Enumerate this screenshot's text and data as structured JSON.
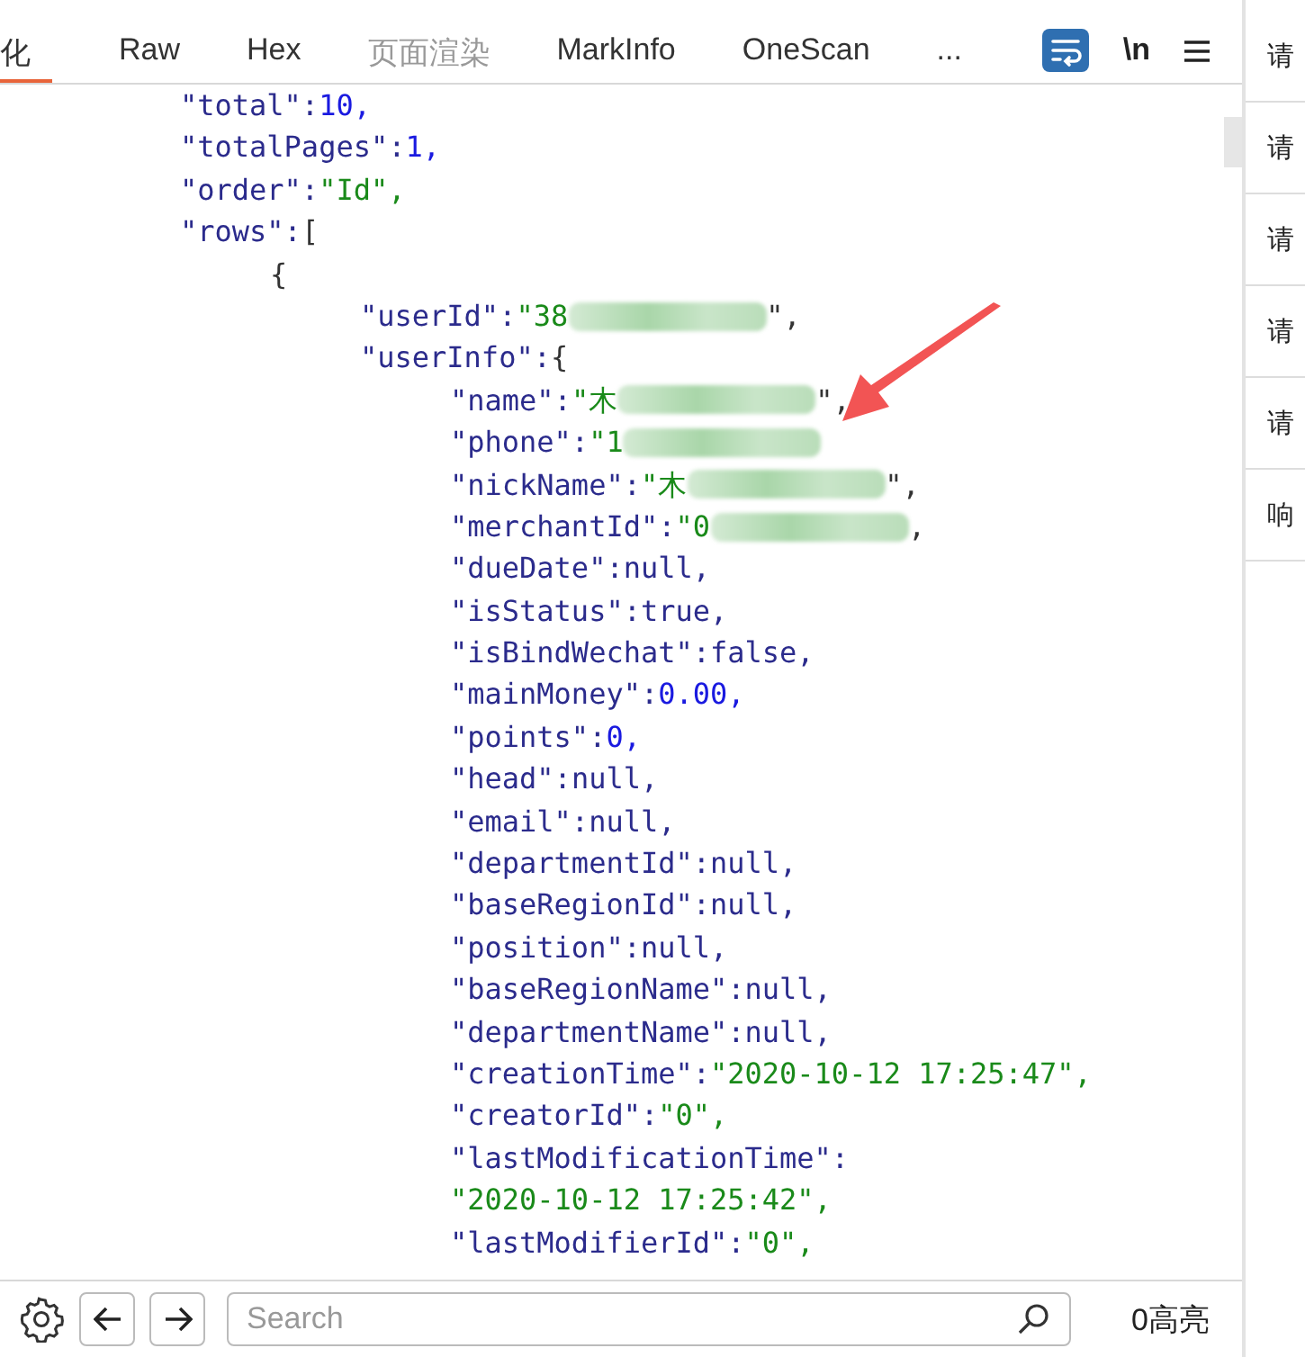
{
  "tabs": [
    {
      "label": "化",
      "selected": true,
      "disabled": false
    },
    {
      "label": "Raw",
      "selected": false,
      "disabled": false
    },
    {
      "label": "Hex",
      "selected": false,
      "disabled": false
    },
    {
      "label": "页面渲染",
      "selected": false,
      "disabled": true
    },
    {
      "label": "MarkInfo",
      "selected": false,
      "disabled": false
    },
    {
      "label": "OneScan",
      "selected": false,
      "disabled": false
    },
    {
      "label": "...",
      "selected": false,
      "disabled": false
    }
  ],
  "toolbar": {
    "wrap_on": true,
    "newline_label": "\\n"
  },
  "json_lines": [
    {
      "key": "\"total\":",
      "value": "10,",
      "kind": "number"
    },
    {
      "key": "\"totalPages\":",
      "value": "1,",
      "kind": "number"
    },
    {
      "key": "\"order\":",
      "value": "\"Id\",",
      "kind": "string"
    },
    {
      "key": "\"rows\":",
      "value": "[",
      "kind": "punct",
      "children": [
        {
          "value": "{",
          "kind": "punct",
          "children": [
            {
              "key": "\"userId\":",
              "value": "\"38",
              "tail": "\",",
              "kind": "string",
              "redacted": true
            },
            {
              "key": "\"userInfo\":",
              "value": "{",
              "kind": "punct",
              "children": [
                {
                  "key": "\"name\":",
                  "value": "\"木",
                  "tail": "\",",
                  "kind": "string",
                  "redacted": true
                },
                {
                  "key": "\"phone\":",
                  "value": "\"1",
                  "kind": "string",
                  "redacted": true
                },
                {
                  "key": "\"nickName\":",
                  "value": "\"木",
                  "tail": "\",",
                  "kind": "string",
                  "redacted": true
                },
                {
                  "key": "\"merchantId\":",
                  "value": "\"0",
                  "tail": ",",
                  "kind": "string",
                  "redacted": true
                },
                {
                  "key": "\"dueDate\":",
                  "value": "null,",
                  "kind": "literal"
                },
                {
                  "key": "\"isStatus\":",
                  "value": "true,",
                  "kind": "literal"
                },
                {
                  "key": "\"isBindWechat\":",
                  "value": "false,",
                  "kind": "literal"
                },
                {
                  "key": "\"mainMoney\":",
                  "value": "0.00,",
                  "kind": "number"
                },
                {
                  "key": "\"points\":",
                  "value": "0,",
                  "kind": "number"
                },
                {
                  "key": "\"head\":",
                  "value": "null,",
                  "kind": "literal"
                },
                {
                  "key": "\"email\":",
                  "value": "null,",
                  "kind": "literal"
                },
                {
                  "key": "\"departmentId\":",
                  "value": "null,",
                  "kind": "literal"
                },
                {
                  "key": "\"baseRegionId\":",
                  "value": "null,",
                  "kind": "literal"
                },
                {
                  "key": "\"position\":",
                  "value": "null,",
                  "kind": "literal"
                },
                {
                  "key": "\"baseRegionName\":",
                  "value": "null,",
                  "kind": "literal"
                },
                {
                  "key": "\"departmentName\":",
                  "value": "null,",
                  "kind": "literal"
                },
                {
                  "key": "\"creationTime\":",
                  "value": "\"2020-10-12 17:25:47\",",
                  "kind": "string"
                },
                {
                  "key": "\"creatorId\":",
                  "value": "\"0\",",
                  "kind": "string"
                },
                {
                  "key": "\"lastModificationTime\":"
                },
                {
                  "value": "\"2020-10-12 17:25:42\",",
                  "kind": "string"
                },
                {
                  "key": "\"lastModifierId\":",
                  "value": "\"0\",",
                  "kind": "string"
                }
              ]
            }
          ]
        }
      ]
    }
  ],
  "search": {
    "placeholder": "Search"
  },
  "highlight_count": "0高亮",
  "side_items": [
    {
      "label": "请"
    },
    {
      "label": "请"
    },
    {
      "label": "请"
    },
    {
      "label": "请"
    },
    {
      "label": "请"
    },
    {
      "label": "响"
    }
  ]
}
